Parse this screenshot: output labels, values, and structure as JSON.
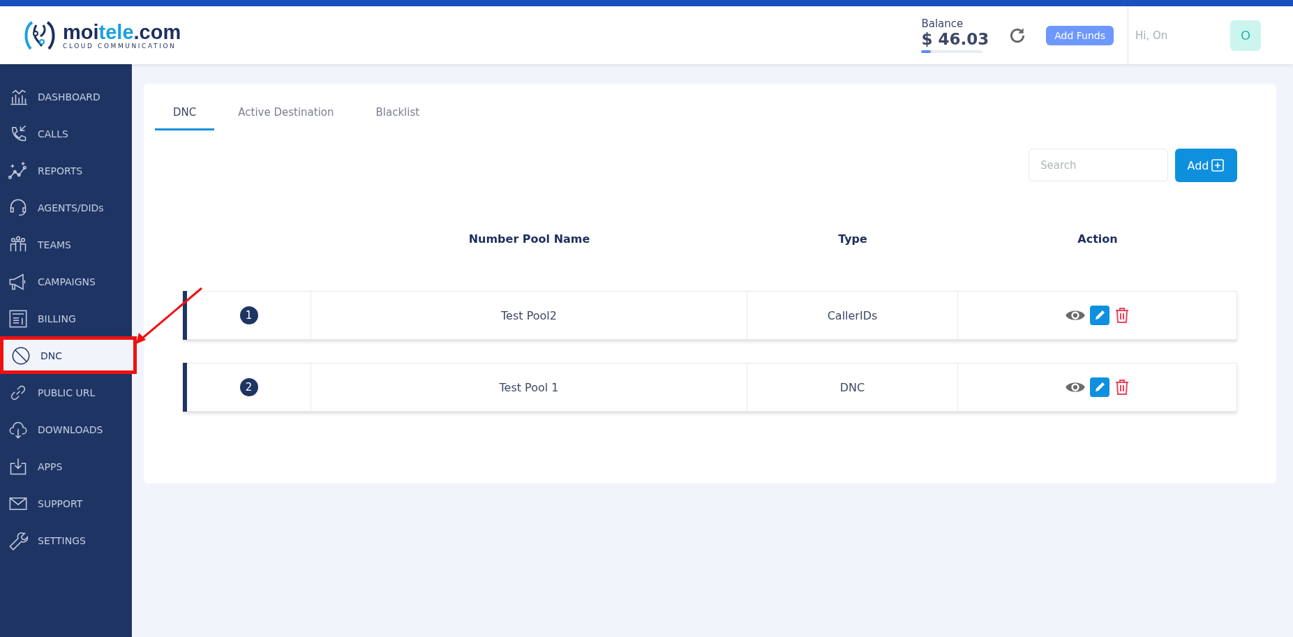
{
  "header": {
    "logo": {
      "name_dark_1": "moi",
      "name_light": "tele",
      "name_dark_2": ".com",
      "tagline": "CLOUD COMMUNICATION"
    },
    "balance": {
      "label": "Balance",
      "amount": "$ 46.03",
      "level": 0.15
    },
    "add_funds": "Add Funds",
    "greeting": "Hi, On",
    "avatar": "O"
  },
  "sidebar": {
    "items": [
      {
        "label": "DASHBOARD",
        "selected": false
      },
      {
        "label": "CALLS",
        "selected": false
      },
      {
        "label": "REPORTS",
        "selected": false
      },
      {
        "label": "AGENTS/DIDs",
        "selected": false
      },
      {
        "label": "TEAMS",
        "selected": false
      },
      {
        "label": "CAMPAIGNS",
        "selected": false
      },
      {
        "label": "BILLING",
        "selected": false
      },
      {
        "label": "DNC",
        "selected": true
      },
      {
        "label": "PUBLIC URL",
        "selected": false
      },
      {
        "label": "DOWNLOADS",
        "selected": false
      },
      {
        "label": "APPS",
        "selected": false
      },
      {
        "label": "SUPPORT",
        "selected": false
      },
      {
        "label": "SETTINGS",
        "selected": false
      }
    ]
  },
  "tabs": [
    {
      "label": "DNC",
      "selected": true
    },
    {
      "label": "Active Destination",
      "selected": false
    },
    {
      "label": "Blacklist",
      "selected": false
    }
  ],
  "search": {
    "placeholder": "Search"
  },
  "add_button": "Add",
  "table": {
    "columns": [
      "Number Pool Name",
      "Type",
      "Action"
    ],
    "rows": [
      {
        "number": "1",
        "name": "Test Pool2",
        "type": "CallerIDs"
      },
      {
        "number": "2",
        "name": "Test Pool 1",
        "type": "DNC"
      }
    ]
  }
}
